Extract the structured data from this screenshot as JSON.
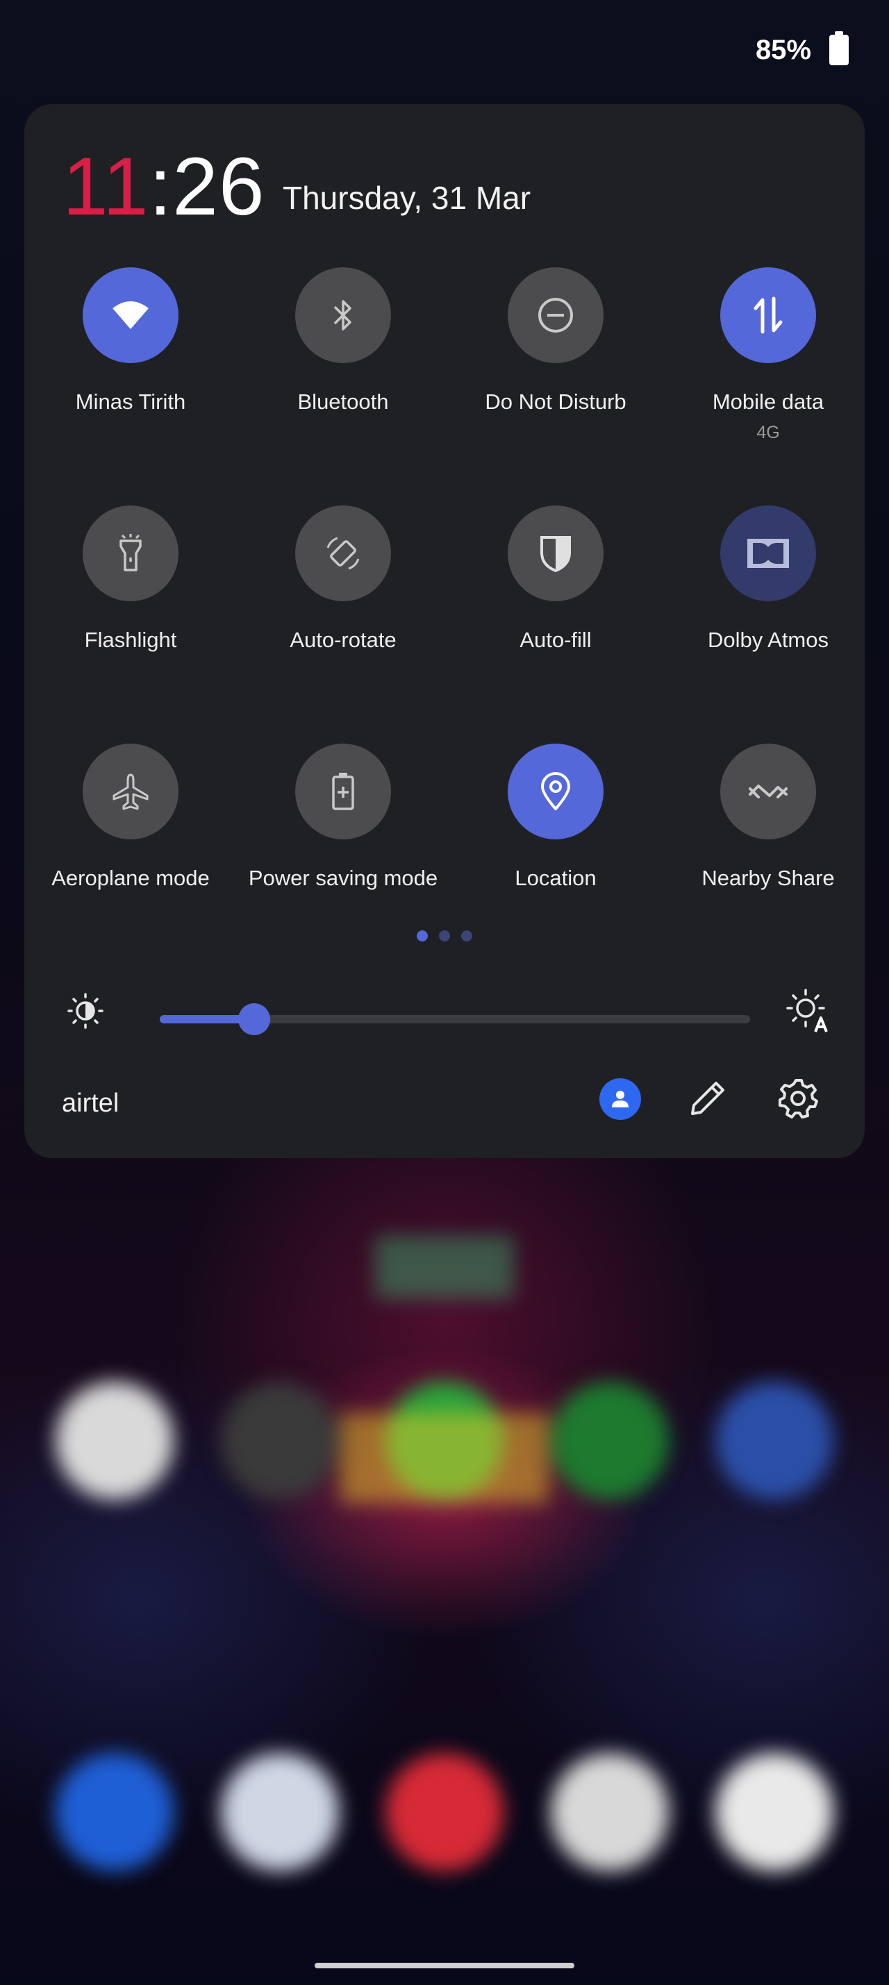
{
  "status_bar": {
    "battery": "85%",
    "battery_icon": "battery-full-icon"
  },
  "panel": {
    "clock": {
      "hours": "11",
      "separator": ":",
      "minutes": "26"
    },
    "date": "Thursday, 31 Mar",
    "tiles": [
      {
        "label": "Minas Tirith",
        "icon": "wifi-icon",
        "active": true
      },
      {
        "label": "Bluetooth",
        "icon": "bluetooth-icon",
        "active": false
      },
      {
        "label": "Do Not Disturb",
        "icon": "do-not-disturb-icon",
        "active": false
      },
      {
        "label": "Mobile data",
        "sub": "4G",
        "icon": "mobile-data-icon",
        "active": true
      },
      {
        "label": "Flashlight",
        "icon": "flashlight-icon",
        "active": false
      },
      {
        "label": "Auto-rotate",
        "icon": "auto-rotate-icon",
        "active": false
      },
      {
        "label": "Auto-fill",
        "icon": "shield-icon",
        "active": false
      },
      {
        "label": "Dolby Atmos",
        "icon": "dolby-icon",
        "active": true
      },
      {
        "label": "Aeroplane mode",
        "icon": "airplane-icon",
        "active": false
      },
      {
        "label": "Power saving mode",
        "icon": "battery-saver-icon",
        "active": false
      },
      {
        "label": "Location",
        "icon": "location-pin-icon",
        "active": true
      },
      {
        "label": "Nearby Share",
        "icon": "nearby-share-icon",
        "active": false
      }
    ],
    "page_indicator": {
      "pages": 3,
      "current": 1
    },
    "brightness": {
      "level_fraction": 0.16,
      "low_icon": "brightness-low-icon",
      "auto_icon": "brightness-auto-icon"
    },
    "carrier": "airtel",
    "actions": {
      "user_icon": "user-icon",
      "edit_icon": "pencil-icon",
      "settings_icon": "gear-icon"
    }
  },
  "colors": {
    "accent": "#5468d9",
    "clock_hours": "#d81f47",
    "panel_bg": "#1f2023",
    "tile_inactive": "#4c4c4e",
    "user_badge": "#2f68f0"
  }
}
